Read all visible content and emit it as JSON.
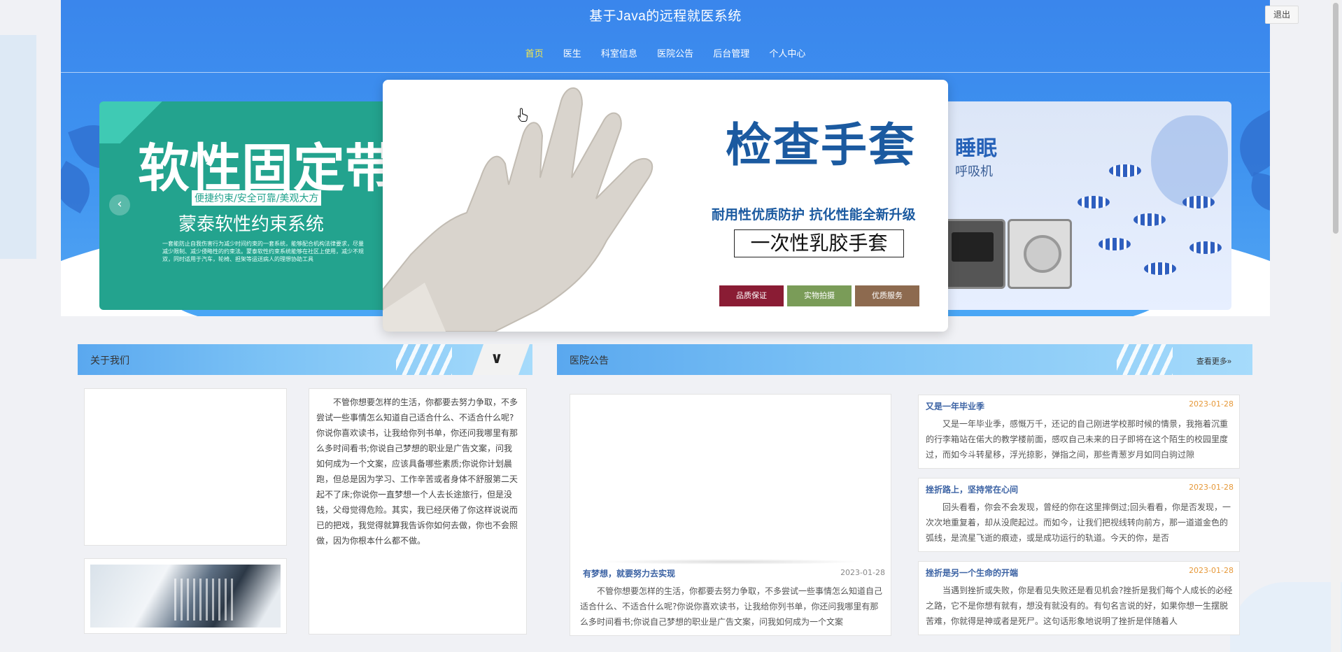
{
  "header": {
    "site_title": "基于Java的远程就医系统",
    "logout_label": "退出"
  },
  "nav": {
    "items": [
      {
        "label": "首页",
        "active": true
      },
      {
        "label": "医生",
        "active": false
      },
      {
        "label": "科室信息",
        "active": false
      },
      {
        "label": "医院公告",
        "active": false
      },
      {
        "label": "后台管理",
        "active": false
      },
      {
        "label": "个人中心",
        "active": false
      }
    ]
  },
  "carousel": {
    "prev_label": "‹",
    "slide_left": {
      "headline": "软性固定带",
      "tagline": "便捷约束/安全可靠/美观大方",
      "product": "蒙泰软性约束系统",
      "desc": "一套能防止自我伤害行为减少时间约束的一套系统，能够配合机构法律要求，尽量减少限制、减少侵略性的约束法。蒙泰软性约束系统能够在社区上使用，减少不规双，同时适用于汽车，轮椅、担架等运送病人的理想协助工具"
    },
    "slide_center": {
      "title": "检查手套",
      "subtitle": "耐用性优质防护  抗化性能全新升级",
      "box_label": "一次性乳胶手套",
      "badges": [
        "品质保证",
        "实物拍摄",
        "优质服务"
      ]
    },
    "slide_right": {
      "title": "睡眠",
      "subtitle": "呼吸机"
    }
  },
  "about": {
    "header_label": "关于我们",
    "text": "不管你想要怎样的生活，你都要去努力争取，不多尝试一些事情怎么知道自己适合什么、不适合什么呢? 你说你喜欢读书，让我给你列书单，你还问我哪里有那么多时间看书;你说自己梦想的职业是广告文案，问我如何成为一个文案，应该具备哪些素质;你说你计划晨跑，但总是因为学习、工作辛苦或者身体不舒服第二天起不了床;你说你一直梦想一个人去长途旅行，但是没钱，父母觉得危险。其实，我已经厌倦了你这样说说而已的把戏，我觉得就算我告诉你如何去做，你也不会照做，因为你根本什么都不做。"
  },
  "notices": {
    "header_label": "医院公告",
    "more_label": "查看更多»",
    "featured": {
      "title": "有梦想，就要努力去实现",
      "date": "2023-01-28",
      "body": "不管你想要怎样的生活，你都要去努力争取，不多尝试一些事情怎么知道自己适合什么、不适合什么呢?你说你喜欢读书，让我给你列书单，你还问我哪里有那么多时间看书;你说自己梦想的职业是广告文案，问我如何成为一个文案"
    },
    "items": [
      {
        "title": "又是一年毕业季",
        "date": "2023-01-28",
        "body": "又是一年毕业季，感慨万千，还记的自己刚进学校那时候的情景，我拖着沉重的行李箱站在偌大的教学楼前面，感叹自己未来的日子即将在这个陌生的校园里度过，而如今斗转星移，浮光掠影，弹指之间，那些青葱岁月如同白驹过隙"
      },
      {
        "title": "挫折路上，坚持常在心间",
        "date": "2023-01-28",
        "body": "回头看看，你会不会发现，曾经的你在这里摔倒过;回头看看，你是否发现，一次次地重复着，却从没爬起过。而如今，让我们把视线转向前方，那一道道金色的弧线，是流星飞逝的痕迹，或是成功运行的轨道。今天的你，是否"
      },
      {
        "title": "挫折是另一个生命的开端",
        "date": "2023-01-28",
        "body": "当遇到挫折或失败，你是看见失败还是看见机会?挫折是我们每个人成长的必经之路，它不是你想有就有，想没有就没有的。有句名言说的好，如果你想一生摆脱苦难，你就得是神或者是死尸。这句话形象地说明了挫折是伴随着人"
      }
    ]
  },
  "colors": {
    "hero_blue": "#3a86ec",
    "nav_active": "#f6e94a",
    "notice_title": "#3c63a4",
    "notice_date": "#e6993a"
  }
}
